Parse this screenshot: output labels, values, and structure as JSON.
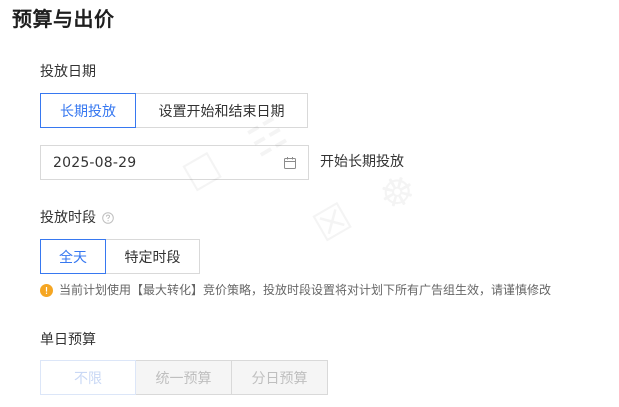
{
  "page": {
    "title": "预算与出价"
  },
  "schedule": {
    "label": "投放日期",
    "options": [
      {
        "label": "长期投放",
        "active": true
      },
      {
        "label": "设置开始和结束日期",
        "active": false
      }
    ],
    "start_date": "2025-08-29",
    "date_suffix": "开始长期投放",
    "calendar_icon": "calendar-icon"
  },
  "time_period": {
    "label": "投放时段",
    "help_icon": "question-circle-icon",
    "options": [
      {
        "label": "全天",
        "active": true
      },
      {
        "label": "特定时段",
        "active": false
      }
    ],
    "notice_icon": "warning-circle-icon",
    "notice": "当前计划使用【最大转化】竞价策略，投放时段设置将对计划下所有广告组生效，请谨慎修改"
  },
  "daily_budget": {
    "label": "单日预算",
    "options": [
      {
        "label": "不限",
        "active": true,
        "disabled": true
      },
      {
        "label": "统一预算",
        "active": false,
        "disabled": true
      },
      {
        "label": "分日预算",
        "active": false,
        "disabled": true
      }
    ]
  },
  "colors": {
    "accent": "#3778f0",
    "warning": "#f5a623",
    "border": "#d9d9d9"
  }
}
